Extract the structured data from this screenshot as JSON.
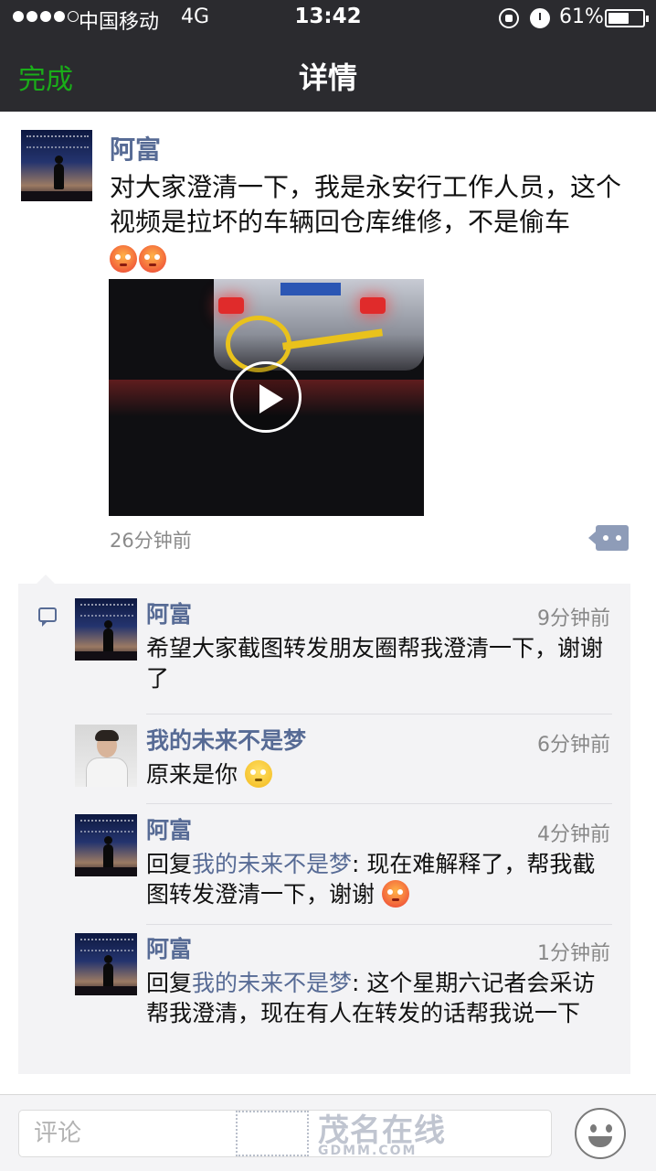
{
  "status_bar": {
    "carrier": "中国移动",
    "network": "4G",
    "time": "13:42",
    "battery_text": "61%",
    "battery_level": 0.61,
    "icons": [
      "signal-dots-icon",
      "orientation-lock-icon",
      "alarm-icon",
      "battery-icon"
    ]
  },
  "nav": {
    "done_label": "完成",
    "title": "详情"
  },
  "post": {
    "author": "阿富",
    "text": "对大家澄清一下，我是永安行工作人员，这个视频是拉坏的车辆回仓库维修，不是偷车",
    "emojis": [
      "flushed-emoji",
      "flushed-emoji"
    ],
    "time": "26分钟前",
    "video_icon": "play-icon",
    "action_icon": "comment-action-icon"
  },
  "comments": [
    {
      "author": "阿富",
      "time": "9分钟前",
      "reply_prefix": "",
      "reply_to": "",
      "text": "希望大家截图转发朋友圈帮我澄清一下，谢谢了",
      "emoji": ""
    },
    {
      "author": "我的未来不是梦",
      "time": "6分钟前",
      "reply_prefix": "",
      "reply_to": "",
      "text": "原来是你",
      "emoji": "thinking-emoji"
    },
    {
      "author": "阿富",
      "time": "4分钟前",
      "reply_prefix": "回复",
      "reply_to": "我的未来不是梦",
      "text": ": 现在难解释了，帮我截图转发澄清一下，谢谢",
      "emoji": "flushed-emoji"
    },
    {
      "author": "阿富",
      "time": "1分钟前",
      "reply_prefix": "回复",
      "reply_to": "我的未来不是梦",
      "text": ": 这个星期六记者会采访帮我澄清，现在有人在转发的话帮我说一下",
      "emoji": ""
    }
  ],
  "input": {
    "placeholder": "评论"
  },
  "watermark": {
    "text": "茂名在线",
    "sub": "GDMM.COM"
  },
  "colors": {
    "accent_green": "#1aad19",
    "link_blue": "#576b95",
    "topbar": "#2b2b2f"
  }
}
